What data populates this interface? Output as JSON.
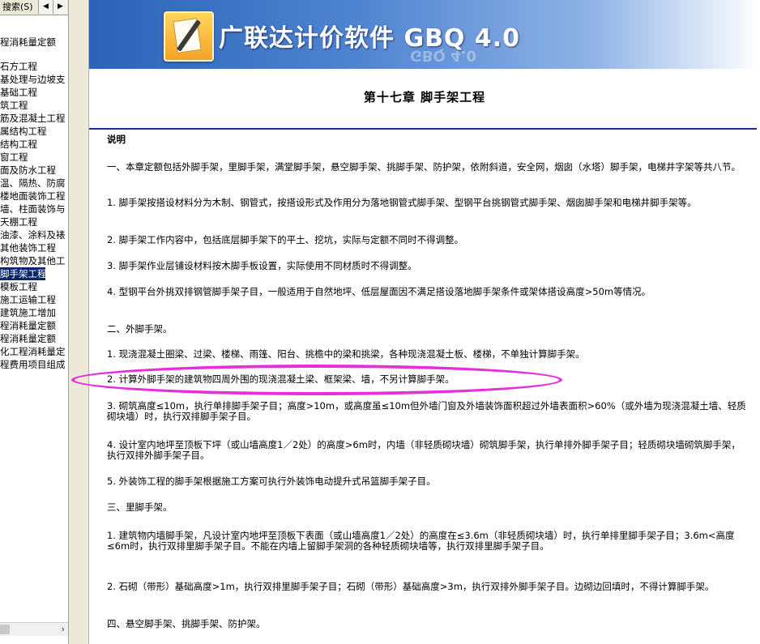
{
  "sidebar": {
    "search_tab": "搜索(S)",
    "back_arrow": "◀",
    "forward_arrow": "▶",
    "tree_items": [
      "程消耗量定额",
      "石方工程",
      "基处理与边坡支",
      "基础工程",
      "筑工程",
      "筋及混凝土工程",
      "属结构工程",
      "结构工程",
      "窗工程",
      "面及防水工程",
      "温、隔热、防腐",
      "楼地面装饰工程",
      "墙、柱面装饰与",
      "天棚工程",
      "油漆、涂料及裱",
      "其他装饰工程",
      "构筑物及其他工",
      "脚手架工程",
      "模板工程",
      "施工运输工程",
      "建筑施工增加",
      "程消耗量定额",
      "程消耗量定额",
      "化工程消耗量定",
      "程费用项目组成"
    ],
    "selected_index": 17,
    "scroll_right": "›"
  },
  "banner": {
    "app_title": "广联达计价软件 GBQ 4.0",
    "reflection": "GBQ 4.0"
  },
  "document": {
    "chapter_title": "第十七章  脚手架工程",
    "paragraphs": [
      "说明",
      "一、本章定额包括外脚手架，里脚手架，满堂脚手架，悬空脚手架、挑脚手架、防护架，依附斜道，安全网，烟囱（水塔）脚手架，电梯井字架等共八节。",
      "1. 脚手架按搭设材料分为木制、钢管式，按搭设形式及作用分为落地钢管式脚手架、型钢平台挑钢管式脚手架、烟囱脚手架和电梯井脚手架等。",
      "2. 脚手架工作内容中，包括底层脚手架下的平土、挖坑，实际与定额不同时不得调整。",
      "3. 脚手架作业层铺设材料按木脚手板设置，实际使用不同材质时不得调整。",
      "4. 型钢平台外挑双排钢管脚手架子目，一般适用于自然地坪、低层屋面因不满足搭设落地脚手架条件或架体搭设高度>50m等情况。",
      "二、外脚手架。",
      "1. 现浇混凝土圈梁、过梁、楼梯、雨篷、阳台、挑檐中的梁和挑梁，各种现浇混凝土板、楼梯，不单独计算脚手架。",
      "2. 计算外脚手架的建筑物四周外围的现浇混凝土梁、框架梁、墙，不另计算脚手架。",
      "3. 砌筑高度≤10m，执行单排脚手架子目；高度>10m，或高度虽≤10m但外墙门窗及外墙装饰面积超过外墙表面积>60%（或外墙为现浇混凝土墙、轻质砌块墙）时，执行双排脚手架子目。",
      "4. 设计室内地坪至顶板下坪（或山墙高度1／2处）的高度>6m时，内墙（非轻质砌块墙）砌筑脚手架，执行单排外脚手架子目；轻质砌块墙砌筑脚手架，执行双排外脚手架子目。",
      "5. 外装饰工程的脚手架根据施工方案可执行外装饰电动提升式吊篮脚手架子目。",
      "三、里脚手架。",
      "1. 建筑物内墙脚手架，凡设计室内地坪至顶板下表面（或山墙高度1／2处）的高度在≤3.6m（非轻质砌块墙）时，执行单排里脚手架子目；3.6m<高度≤6m时，执行双排里脚手架子目。不能在内墙上留脚手架洞的各种轻质砌块墙等，执行双排里脚手架子目。",
      "2. 石砌（带形）基础高度>1m，执行双排里脚手架子目；石砌（带形）基础高度>3m，执行双排外脚手架子目。边砌边回填时，不得计算脚手架。",
      "四、悬空脚手架、挑脚手架、防护架。"
    ]
  },
  "colors": {
    "highlight": "#e62fd8",
    "rule": "#1a2b8a",
    "selection": "#0a246a"
  }
}
